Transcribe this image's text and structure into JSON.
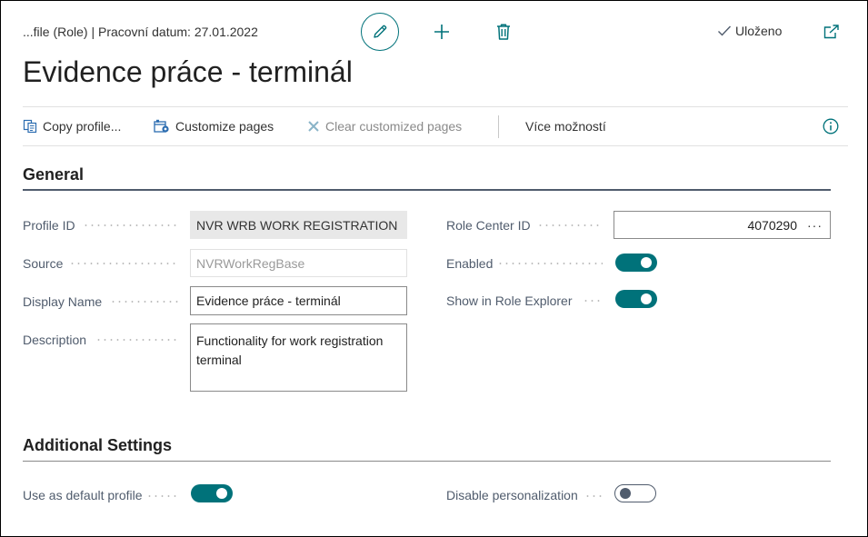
{
  "header": {
    "breadcrumb": "...file (Role) | Pracovní datum: 27.01.2022",
    "saved_label": "Uloženo",
    "title": "Evidence práce - terminál",
    "icons": [
      "edit-icon",
      "add-icon",
      "delete-icon",
      "checkmark-icon",
      "open-new-window-icon"
    ]
  },
  "actions": {
    "copy_profile": "Copy profile...",
    "customize_pages": "Customize pages",
    "clear_customized_pages": "Clear customized pages",
    "more_options": "Více možností"
  },
  "general": {
    "title": "General",
    "profile_id": {
      "label": "Profile ID",
      "value": "NVR WRB WORK REGISTRATION"
    },
    "source": {
      "label": "Source",
      "value": "NVRWorkRegBase"
    },
    "display_name": {
      "label": "Display Name",
      "value": "Evidence práce - terminál"
    },
    "description": {
      "label": "Description",
      "value": "Functionality for work registration terminal"
    },
    "role_center_id": {
      "label": "Role Center ID",
      "value": "4070290",
      "lookup": "···"
    },
    "enabled": {
      "label": "Enabled",
      "state": true
    },
    "show_in_role_explorer": {
      "label": "Show in Role Explorer",
      "state": true
    }
  },
  "additional": {
    "title": "Additional Settings",
    "use_as_default_profile": {
      "label": "Use as default profile",
      "state": true
    },
    "disable_personalization": {
      "label": "Disable personalization",
      "state": false
    }
  },
  "colors": {
    "accent": "#00727a",
    "label": "#505c6d",
    "readonly_bg": "#e8e8e8"
  }
}
